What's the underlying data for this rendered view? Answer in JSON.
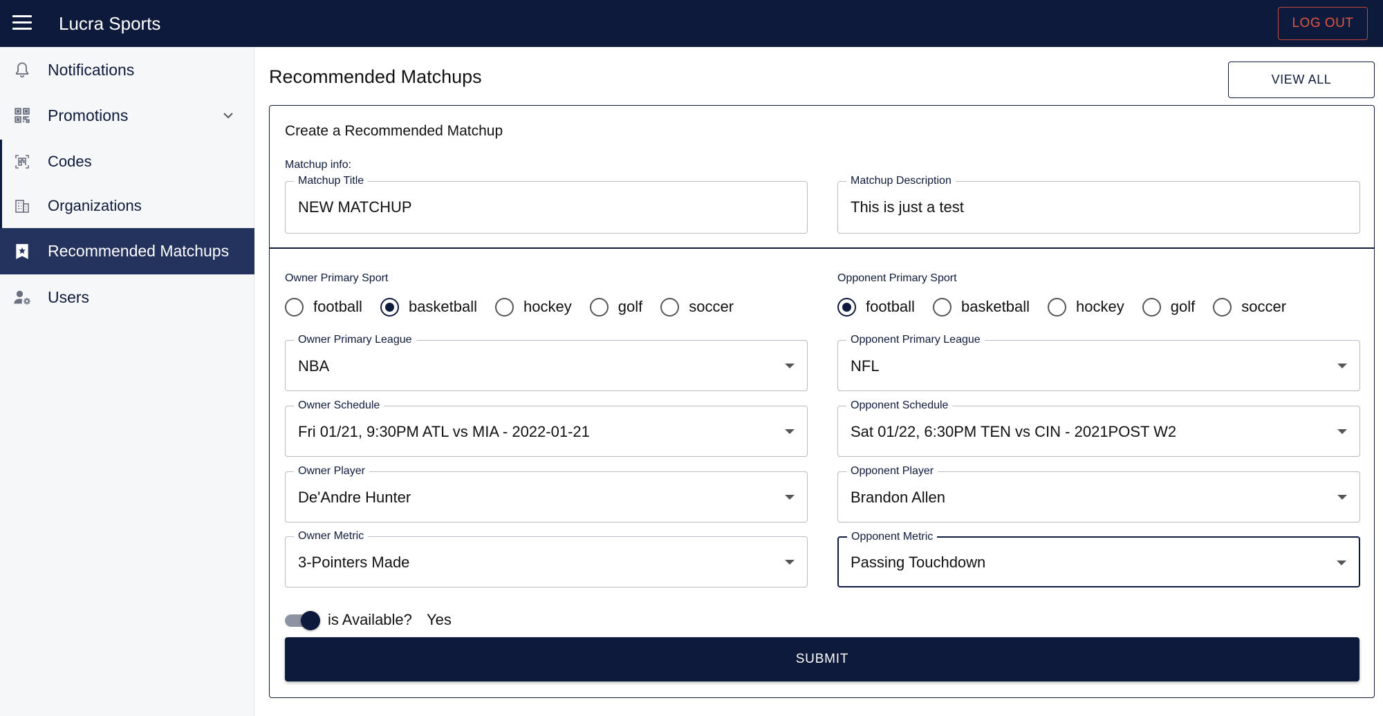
{
  "app": {
    "title": "Lucra Sports",
    "logout_label": "LOG OUT"
  },
  "sidebar": {
    "items": [
      {
        "label": "Notifications",
        "icon": "bell-icon"
      },
      {
        "label": "Promotions",
        "icon": "qr-code-icon",
        "expanded": true
      },
      {
        "label": "Codes",
        "icon": "qr-scan-icon"
      },
      {
        "label": "Organizations",
        "icon": "building-icon"
      },
      {
        "label": "Recommended Matchups",
        "icon": "star-badge-icon",
        "active": true
      },
      {
        "label": "Users",
        "icon": "user-settings-icon"
      }
    ]
  },
  "page": {
    "title": "Recommended Matchups",
    "view_all_label": "VIEW ALL"
  },
  "form": {
    "title": "Create a Recommended Matchup",
    "matchup_info_label": "Matchup info:",
    "matchup_title": {
      "label": "Matchup Title",
      "value": "NEW MATCHUP"
    },
    "matchup_description": {
      "label": "Matchup Description",
      "value": "This is just a test"
    },
    "owner": {
      "sport_label": "Owner Primary Sport",
      "sports": [
        "football",
        "basketball",
        "hockey",
        "golf",
        "soccer"
      ],
      "selected_sport": "basketball",
      "league": {
        "label": "Owner Primary League",
        "value": "NBA"
      },
      "schedule": {
        "label": "Owner Schedule",
        "value": "Fri 01/21, 9:30PM ATL vs MIA - 2022-01-21"
      },
      "player": {
        "label": "Owner Player",
        "value": "De'Andre Hunter"
      },
      "metric": {
        "label": "Owner Metric",
        "value": "3-Pointers Made"
      }
    },
    "opponent": {
      "sport_label": "Opponent Primary Sport",
      "sports": [
        "football",
        "basketball",
        "hockey",
        "golf",
        "soccer"
      ],
      "selected_sport": "football",
      "league": {
        "label": "Opponent Primary League",
        "value": "NFL"
      },
      "schedule": {
        "label": "Opponent Schedule",
        "value": "Sat 01/22, 6:30PM TEN vs CIN - 2021POST W2"
      },
      "player": {
        "label": "Opponent Player",
        "value": "Brandon Allen"
      },
      "metric": {
        "label": "Opponent Metric",
        "value": "Passing Touchdown"
      }
    },
    "availability": {
      "label": "is Available?",
      "value": "Yes",
      "checked": true
    },
    "submit_label": "SUBMIT"
  },
  "colors": {
    "primary": "#0e1a3b",
    "active_nav": "#24335e",
    "logout": "#e0563f"
  }
}
